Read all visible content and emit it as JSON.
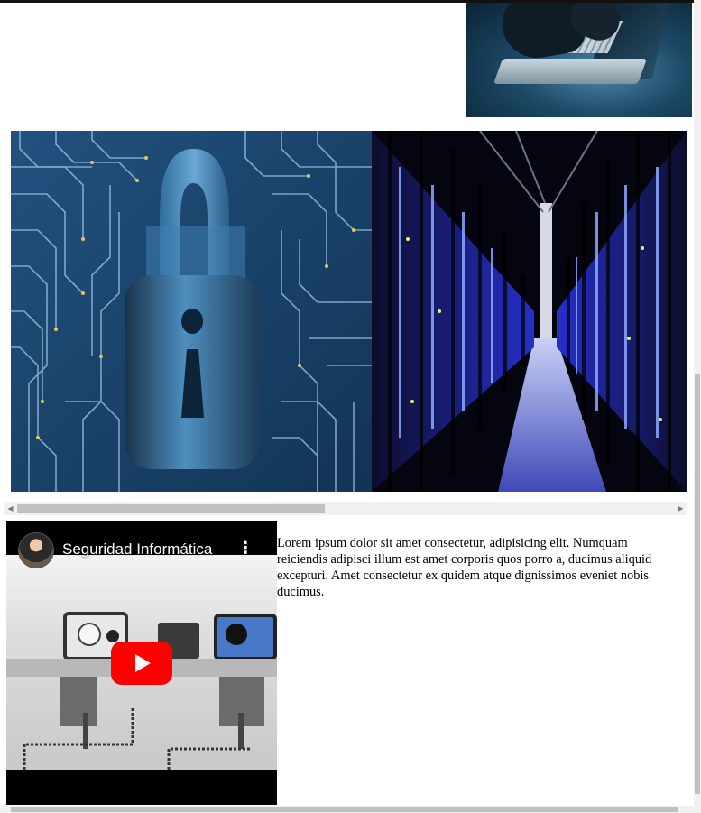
{
  "images": {
    "laptop": {
      "alt": "laptop-typing-image"
    },
    "lock": {
      "alt": "circuit-padlock-image"
    },
    "servers": {
      "alt": "data-center-servers-image"
    }
  },
  "video": {
    "title": "Seguridad Informática",
    "menu_icon": "⋮"
  },
  "content": {
    "paragraph": "Lorem ipsum dolor sit amet consectetur, adipisicing elit. Numquam reiciendis adipisci illum est amet corporis quos porro a, ducimus aliquid excepturi. Amet consectetur ex quidem atque dignissimos eveniet nobis ducimus."
  },
  "scrollbar": {
    "left_arrow": "◀",
    "right_arrow": "▶"
  },
  "colors": {
    "youtube_red": "#ff0000",
    "scroll_track": "#f1f1f1",
    "scroll_thumb": "#c1c1c1"
  }
}
